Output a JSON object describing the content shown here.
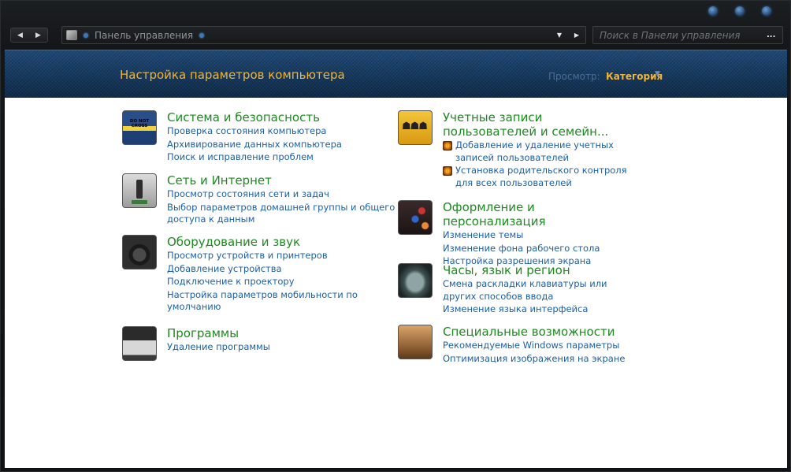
{
  "window": {
    "controls": [
      "minimize",
      "maximize",
      "close"
    ]
  },
  "toolbar": {
    "back_icon": "arrow-left",
    "forward_icon": "arrow-right",
    "address": {
      "icon": "control-panel-icon",
      "crumb": "Панель управления"
    },
    "search": {
      "placeholder": "Поиск в Панели управления",
      "value": ""
    }
  },
  "banner": {
    "title": "Настройка параметров компьютера",
    "view_label": "Просмотр:",
    "view_value": "Категория"
  },
  "categories_left": [
    {
      "title": "Система и безопасность",
      "icon": "security-icon",
      "links": [
        "Проверка состояния компьютера",
        "Архивирование данных компьютера",
        "Поиск и исправление проблем"
      ]
    },
    {
      "title": "Сеть и Интернет",
      "icon": "network-icon",
      "links": [
        "Просмотр состояния сети и задач",
        "Выбор параметров домашней группы и общего доступа к данным"
      ]
    },
    {
      "title": "Оборудование и звук",
      "icon": "hardware-sound-icon",
      "links": [
        "Просмотр устройств и принтеров",
        "Добавление устройства",
        "Подключение к проектору",
        "Настройка параметров мобильности по умолчанию"
      ]
    },
    {
      "title": "Программы",
      "icon": "programs-icon",
      "links": [
        "Удаление программы"
      ]
    }
  ],
  "categories_right": [
    {
      "title": "Учетные записи пользователей и семейн...",
      "icon": "user-accounts-icon",
      "links": [
        "Добавление и удаление учетных записей пользователей",
        "Установка родительского контроля для всех пользователей"
      ]
    },
    {
      "title": "Оформление и персонализация",
      "icon": "appearance-icon",
      "links": [
        "Изменение темы",
        "Изменение фона рабочего стола",
        "Настройка разрешения экрана"
      ]
    },
    {
      "title": "Часы, язык и регион",
      "icon": "clock-language-region-icon",
      "links": [
        "Смена раскладки клавиатуры или других способов ввода",
        "Изменение языка интерфейса"
      ]
    },
    {
      "title": "Специальные возможности",
      "icon": "ease-of-access-icon",
      "links": [
        "Рекомендуемые Windows параметры",
        "Оптимизация изображения на экране"
      ]
    }
  ]
}
